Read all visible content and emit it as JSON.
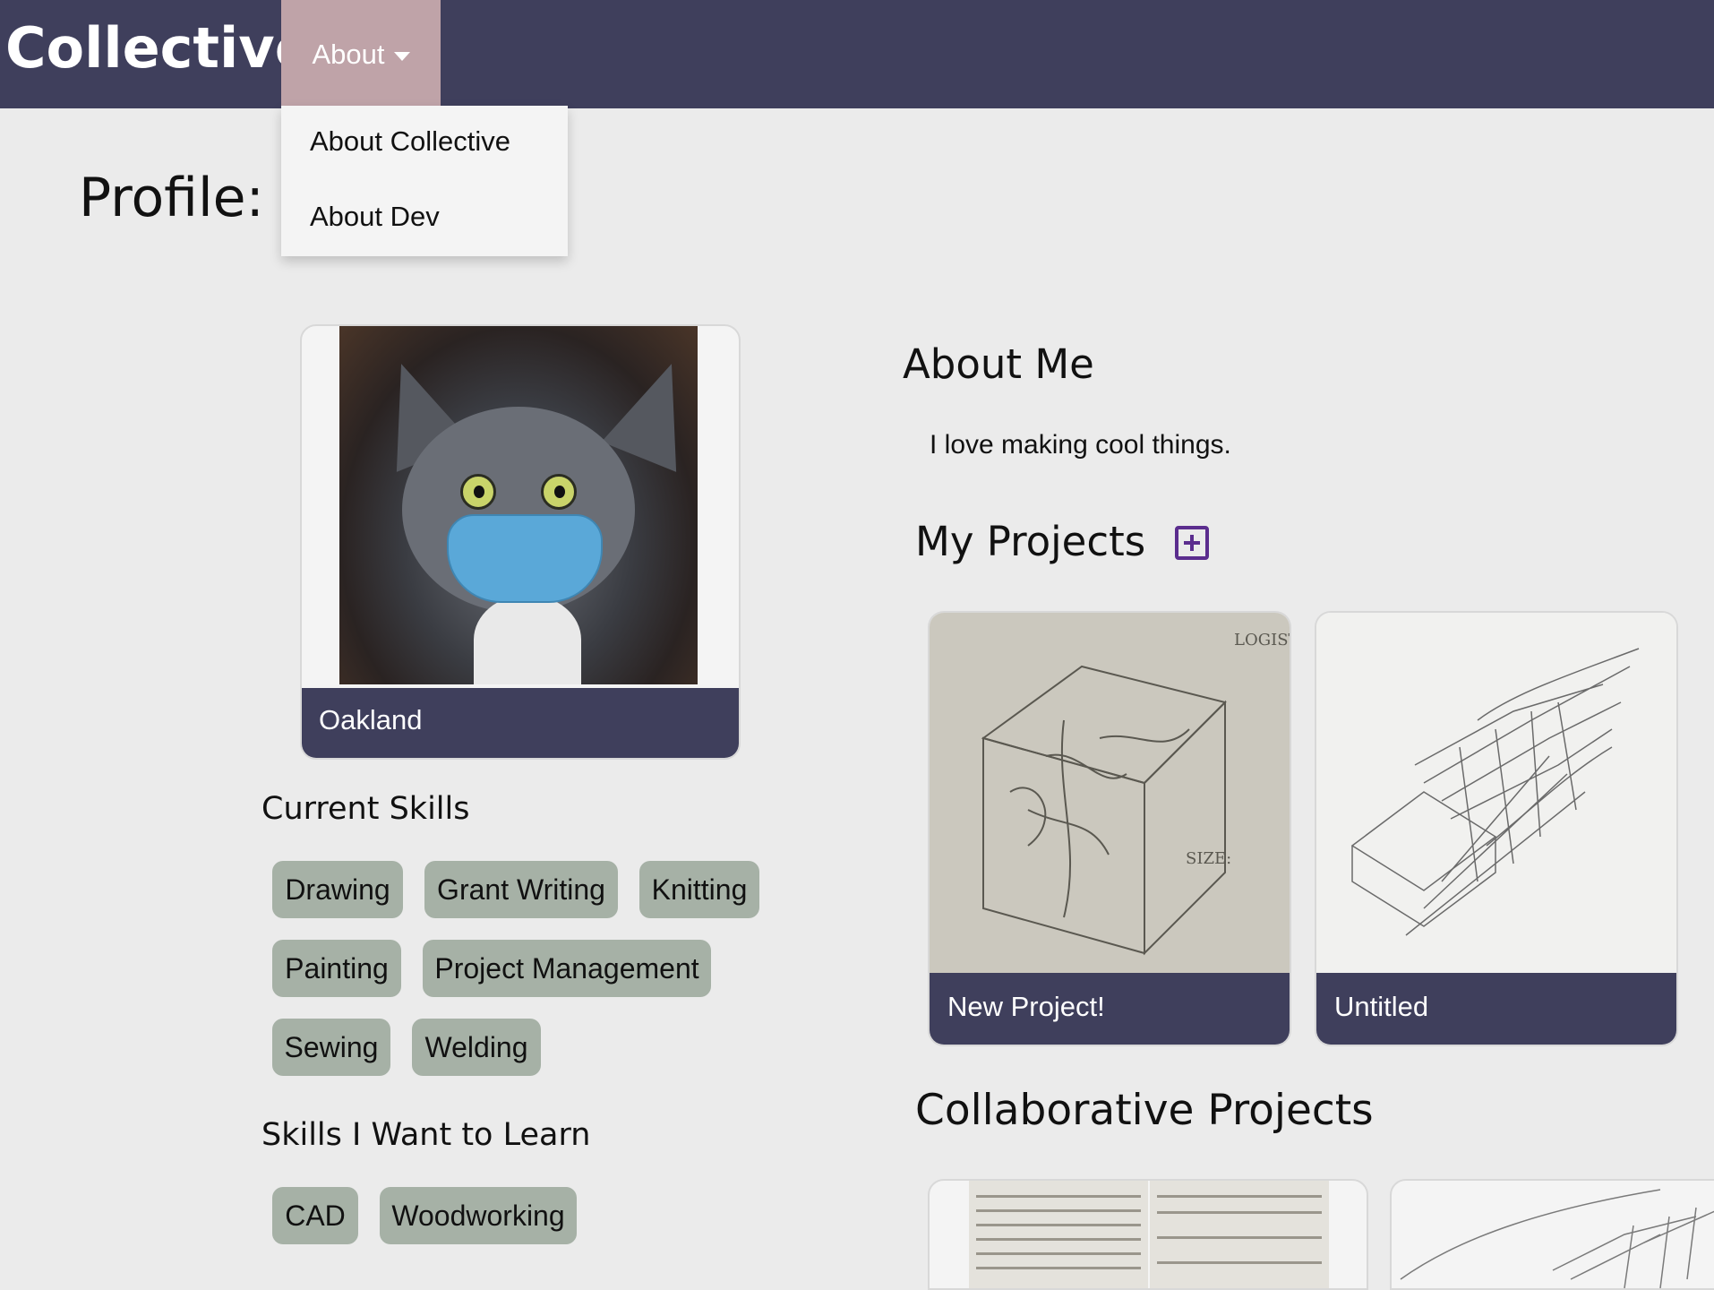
{
  "nav": {
    "brand": "Collective",
    "about_label": "About",
    "dropdown": [
      "About Collective",
      "About Dev"
    ]
  },
  "page_title": "Profile: g",
  "profile": {
    "location": "Oakland",
    "photo_alt": "cat wearing mask"
  },
  "skills": {
    "heading": "Current Skills",
    "items": [
      "Drawing",
      "Grant Writing",
      "Knitting",
      "Painting",
      "Project Management",
      "Sewing",
      "Welding"
    ]
  },
  "learn": {
    "heading": "Skills I Want to Learn",
    "items": [
      "CAD",
      "Woodworking"
    ]
  },
  "about": {
    "heading": "About Me",
    "text": "I love making cool things."
  },
  "projects": {
    "heading": "My Projects",
    "items": [
      {
        "name": "New Project!"
      },
      {
        "name": "Untitled"
      }
    ]
  },
  "collab": {
    "heading": "Collaborative Projects"
  },
  "colors": {
    "nav_bg": "#3f3f5c",
    "nav_active": "#bfa3a8",
    "chip_bg": "#a6b1a6",
    "page_bg": "#ebebeb",
    "add_icon": "#5b2d8e"
  }
}
